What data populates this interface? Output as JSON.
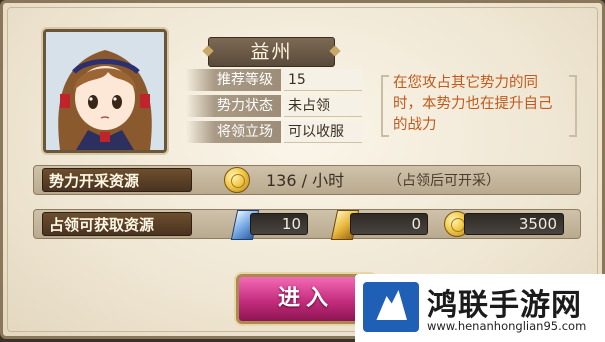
{
  "territory": {
    "name": "益州",
    "info": [
      {
        "label": "推荐等级",
        "value": "15"
      },
      {
        "label": "势力状态",
        "value": "未占领"
      },
      {
        "label": "将领立场",
        "value": "可以收服"
      }
    ],
    "note": "在您攻占其它势力的同时，本势力也在提升自己的战力"
  },
  "production": {
    "label": "势力开采资源",
    "rate": "136 / 小时",
    "note": "（占领后可开采）"
  },
  "rewards": {
    "label": "占领可获取资源",
    "items": [
      {
        "icon": "blue-crystal-icon",
        "value": "10"
      },
      {
        "icon": "gold-token-icon",
        "value": "0"
      },
      {
        "icon": "gold-coin-icon",
        "value": "3500"
      }
    ]
  },
  "enter_button": "进入",
  "watermark": {
    "title": "鸿联手游网",
    "url": "www.henanhonglian95.com"
  }
}
